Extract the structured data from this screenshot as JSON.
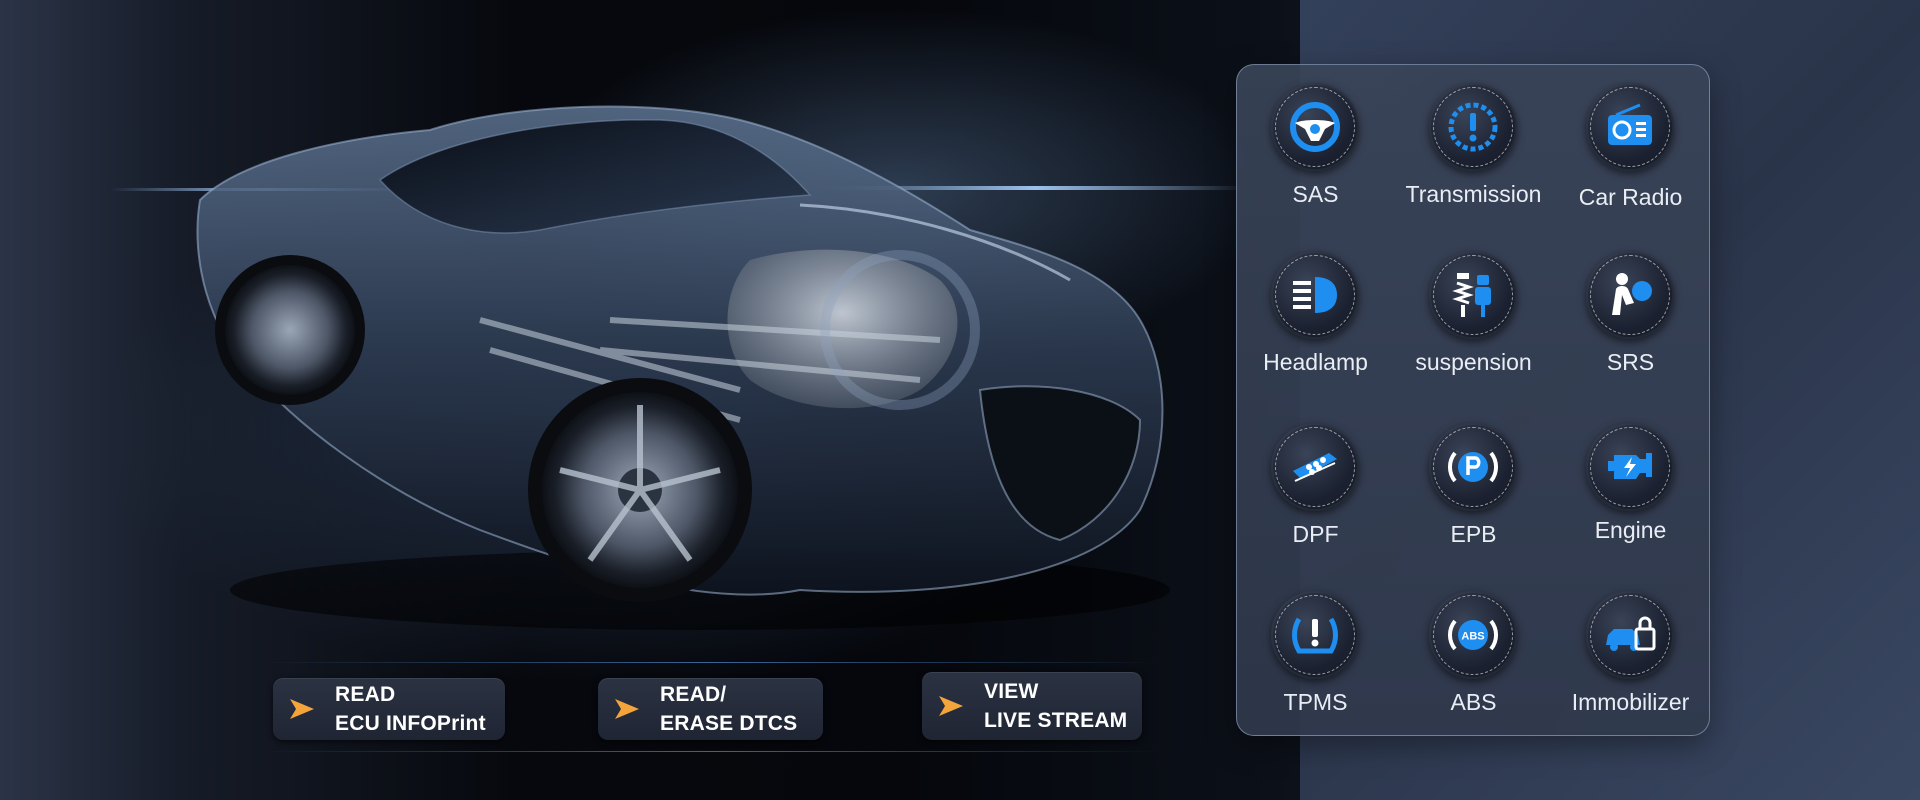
{
  "colors": {
    "accent_blue": "#1e8ef0",
    "arrow_orange": "#f3a43a",
    "label_text": "#e9edf4",
    "panel_border": "#a0b4d2"
  },
  "features": [
    {
      "line1": "READ",
      "line2": "ECU INFOPrint",
      "icon": "orange-arrow-icon"
    },
    {
      "line1": "READ/",
      "line2": "ERASE DTCS",
      "icon": "orange-arrow-icon"
    },
    {
      "line1": "VIEW",
      "line2": "LIVE STREAM",
      "icon": "orange-arrow-icon"
    }
  ],
  "functions": [
    {
      "label": "SAS",
      "icon": "steering-wheel-icon"
    },
    {
      "label": "Transmission",
      "icon": "transmission-warning-icon"
    },
    {
      "label": "Car Radio",
      "icon": "radio-icon"
    },
    {
      "label": "Headlamp",
      "icon": "headlamp-icon"
    },
    {
      "label": "suspension",
      "icon": "suspension-icon"
    },
    {
      "label": "SRS",
      "icon": "airbag-icon"
    },
    {
      "label": "DPF",
      "icon": "particulate-filter-icon"
    },
    {
      "label": "EPB",
      "icon": "parking-brake-icon"
    },
    {
      "label": "Engine",
      "icon": "engine-icon"
    },
    {
      "label": "TPMS",
      "icon": "tire-pressure-icon"
    },
    {
      "label": "ABS",
      "icon": "abs-icon"
    },
    {
      "label": "Immobilizer",
      "icon": "immobilizer-icon"
    }
  ]
}
